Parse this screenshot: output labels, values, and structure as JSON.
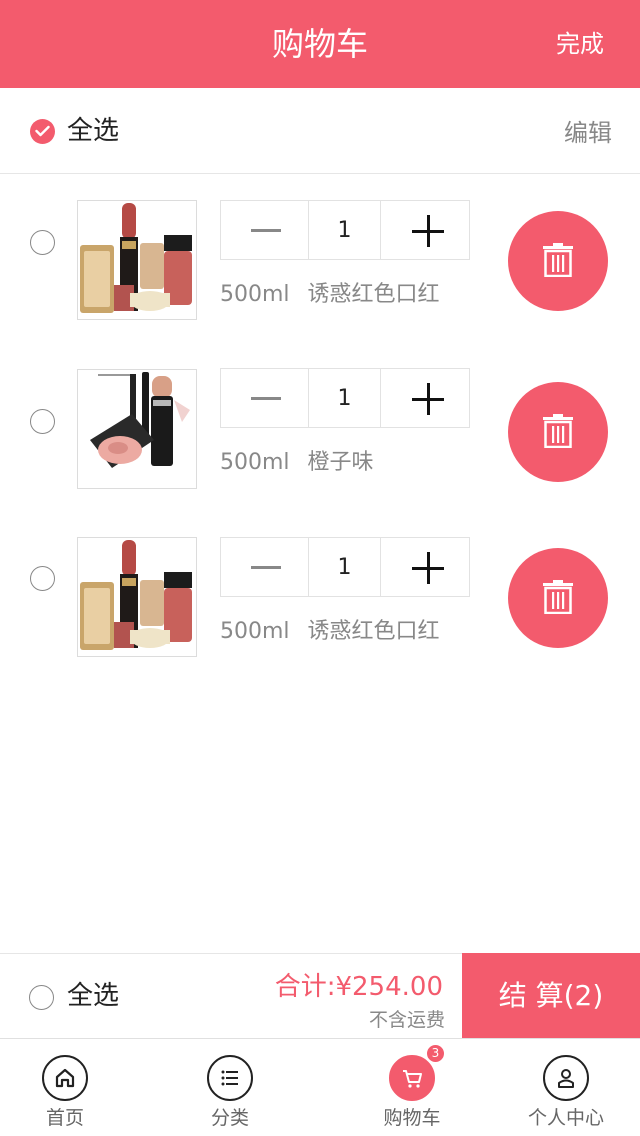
{
  "header": {
    "title": "购物车",
    "done_label": "完成"
  },
  "select_all": {
    "label": "全选",
    "edit_label": "编辑",
    "checked": true
  },
  "items": [
    {
      "quantity": "1",
      "volume": "500ml",
      "name": "诱惑红色口红",
      "image": "makeup-set-lipstick-image"
    },
    {
      "quantity": "1",
      "volume": "500ml",
      "name": "橙子味",
      "image": "makeup-blush-mascara-image"
    },
    {
      "quantity": "1",
      "volume": "500ml",
      "name": "诱惑红色口红",
      "image": "makeup-set-lipstick-image"
    }
  ],
  "checkout": {
    "select_all_label": "全选",
    "total_label": "合计:",
    "total_value": "¥254.00",
    "shipping_note": "不含运费",
    "pay_label": "结 算(2)"
  },
  "tabbar": {
    "tabs": [
      {
        "label": "首页",
        "icon": "home-icon"
      },
      {
        "label": "分类",
        "icon": "list-icon"
      },
      {
        "label": "购物车",
        "icon": "cart-icon",
        "badge": "3",
        "active": true
      },
      {
        "label": "个人中心",
        "icon": "person-icon"
      }
    ]
  },
  "colors": {
    "accent": "#f35b6d",
    "text_muted": "#888888",
    "border": "#e2e2e2"
  }
}
